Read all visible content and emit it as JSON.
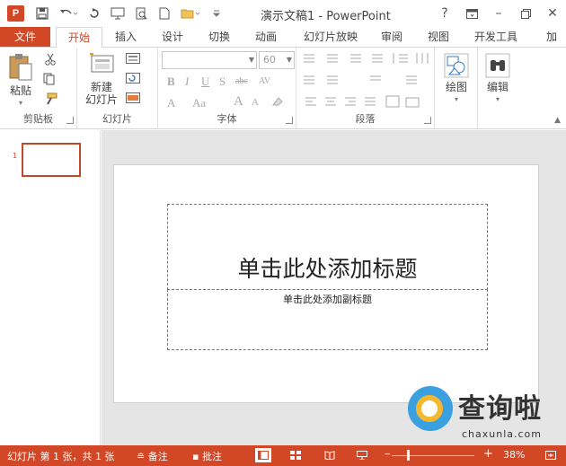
{
  "titlebar": {
    "app_icon": "P",
    "title": "演示文稿1 - PowerPoint",
    "help": "?",
    "minimize": "–",
    "close": "✕"
  },
  "tabs": [
    {
      "label": "文件"
    },
    {
      "label": "开始"
    },
    {
      "label": "插入"
    },
    {
      "label": "设计"
    },
    {
      "label": "切换"
    },
    {
      "label": "动画"
    },
    {
      "label": "幻灯片放映"
    },
    {
      "label": "审阅"
    },
    {
      "label": "视图"
    },
    {
      "label": "开发工具"
    },
    {
      "label": "加"
    }
  ],
  "ribbon": {
    "clipboard": {
      "paste_label": "粘贴",
      "group_label": "剪贴板"
    },
    "slides": {
      "new_slide_line1": "新建",
      "new_slide_line2": "幻灯片",
      "group_label": "幻灯片"
    },
    "font": {
      "font_size": "60",
      "group_label": "字体",
      "bold": "B",
      "italic": "I",
      "underline": "U",
      "shadow": "S",
      "strike": "abc",
      "spacing": "AV",
      "font_color": "A",
      "case": "Aa",
      "grow": "A",
      "shrink": "A"
    },
    "paragraph": {
      "group_label": "段落"
    },
    "drawing": {
      "label": "绘图"
    },
    "editing": {
      "label": "编辑"
    }
  },
  "thumbnails": [
    {
      "number": "1"
    }
  ],
  "slide": {
    "title_placeholder": "单击此处添加标题",
    "subtitle_placeholder": "单击此处添加副标题"
  },
  "watermark": {
    "name": "查询啦",
    "url": "chaxunla.com"
  },
  "statusbar": {
    "slide_info": "幻灯片 第 1 张，共 1 张",
    "notes": "备注",
    "comments": "批注",
    "zoom_minus": "–",
    "zoom_plus": "+",
    "zoom_level": "38%"
  },
  "colors": {
    "accent": "#d24726",
    "slide_bg": "#ffffff",
    "canvas_bg": "#e5e5e5"
  }
}
